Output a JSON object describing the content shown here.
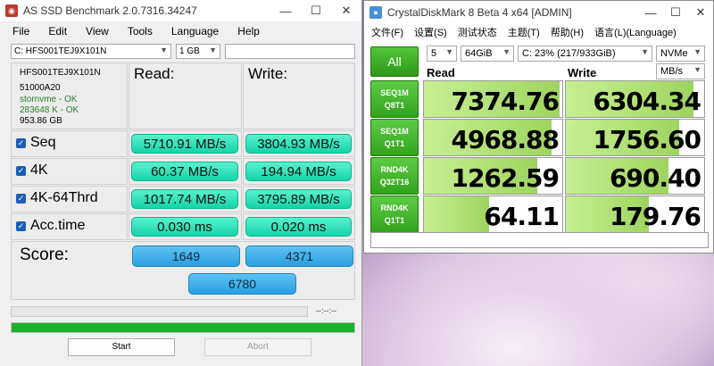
{
  "as_ssd": {
    "title": "AS SSD Benchmark 2.0.7316.34247",
    "window_controls": {
      "minimize": "—",
      "maximize": "☐",
      "close": "✕"
    },
    "menu": [
      "File",
      "Edit",
      "View",
      "Tools",
      "Language",
      "Help"
    ],
    "drive_select": "C: HFS001TEJ9X101N",
    "size_select": "1 GB",
    "drive_info": {
      "model": "HFS001TEJ9X101N",
      "firmware": "51000A20",
      "driver": "stornvme - OK",
      "alignment": "283648 K - OK",
      "capacity": "953.86 GB"
    },
    "headers": {
      "read": "Read:",
      "write": "Write:"
    },
    "rows": [
      {
        "label": "Seq",
        "read": "5710.91 MB/s",
        "write": "3804.93 MB/s"
      },
      {
        "label": "4K",
        "read": "60.37 MB/s",
        "write": "194.94 MB/s"
      },
      {
        "label": "4K-64Thrd",
        "read": "1017.74 MB/s",
        "write": "3795.89 MB/s"
      },
      {
        "label": "Acc.time",
        "read": "0.030 ms",
        "write": "0.020 ms"
      }
    ],
    "score": {
      "label": "Score:",
      "read": "1649",
      "write": "4371",
      "total": "6780"
    },
    "progress": {
      "time": "--:--:--",
      "fraction": 1.0
    },
    "buttons": {
      "start": "Start",
      "abort": "Abort"
    },
    "colors": {
      "value_box": "#1ed8ab",
      "score_box": "#3aacea",
      "progress": "#19b32c"
    }
  },
  "cdm": {
    "title": "CrystalDiskMark 8 Beta 4 x64 [ADMIN]",
    "window_controls": {
      "minimize": "—",
      "maximize": "☐",
      "close": "✕"
    },
    "menu": [
      "文件(F)",
      "设置(S)",
      "测试状态",
      "主题(T)",
      "帮助(H)",
      "语言(L)(Language)"
    ],
    "count_select": "5",
    "size_select": "64GiB",
    "drive_select": "C: 23% (217/933GiB)",
    "mode_select": "NVMe",
    "unit_select": "MB/s",
    "all_button": "All",
    "headers": {
      "read": "Read",
      "write": "Write"
    },
    "tests": [
      {
        "line1": "SEQ1M",
        "line2": "Q8T1",
        "read": "7374.76",
        "write": "6304.34",
        "read_fill": 0.98,
        "write_fill": 0.92
      },
      {
        "line1": "SEQ1M",
        "line2": "Q1T1",
        "read": "4968.88",
        "write": "1756.60",
        "read_fill": 0.92,
        "write_fill": 0.82
      },
      {
        "line1": "RND4K",
        "line2": "Q32T16",
        "read": "1262.59",
        "write": "690.40",
        "read_fill": 0.82,
        "write_fill": 0.74
      },
      {
        "line1": "RND4K",
        "line2": "Q1T1",
        "read": "64.11",
        "write": "179.76",
        "read_fill": 0.47,
        "write_fill": 0.6
      }
    ],
    "status": "",
    "colors": {
      "all_button": "#3aaa24",
      "meter_fill": "#b5e27b"
    }
  }
}
